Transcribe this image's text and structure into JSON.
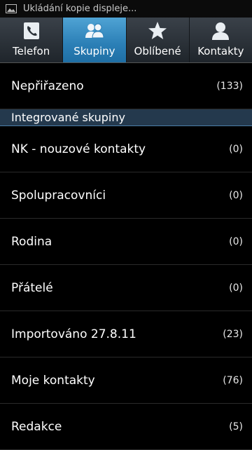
{
  "status_bar": {
    "notification_text": "Ukládání kopie displeje...",
    "icon": "screenshot-image-icon"
  },
  "tabs": [
    {
      "label": "Telefon",
      "icon": "phone-icon",
      "active": false
    },
    {
      "label": "Skupiny",
      "icon": "groups-icon",
      "active": true
    },
    {
      "label": "Oblíbené",
      "icon": "star-icon",
      "active": false
    },
    {
      "label": "Kontakty",
      "icon": "person-icon",
      "active": false
    }
  ],
  "unassigned": {
    "label": "Nepřiřazeno",
    "count": "(133)"
  },
  "section": {
    "title": "Integrované skupiny"
  },
  "groups": [
    {
      "label": "NK - nouzové kontakty",
      "count": "(0)"
    },
    {
      "label": "Spolupracovníci",
      "count": "(0)"
    },
    {
      "label": "Rodina",
      "count": "(0)"
    },
    {
      "label": "Přátelé",
      "count": "(0)"
    },
    {
      "label": "Importováno 27.8.11",
      "count": "(23)"
    },
    {
      "label": "Moje kontakty",
      "count": "(76)"
    },
    {
      "label": "Redakce",
      "count": "(5)"
    }
  ],
  "colors": {
    "active_tab": "#2f8bc4",
    "section_header": "#24394d",
    "background": "#000000"
  }
}
